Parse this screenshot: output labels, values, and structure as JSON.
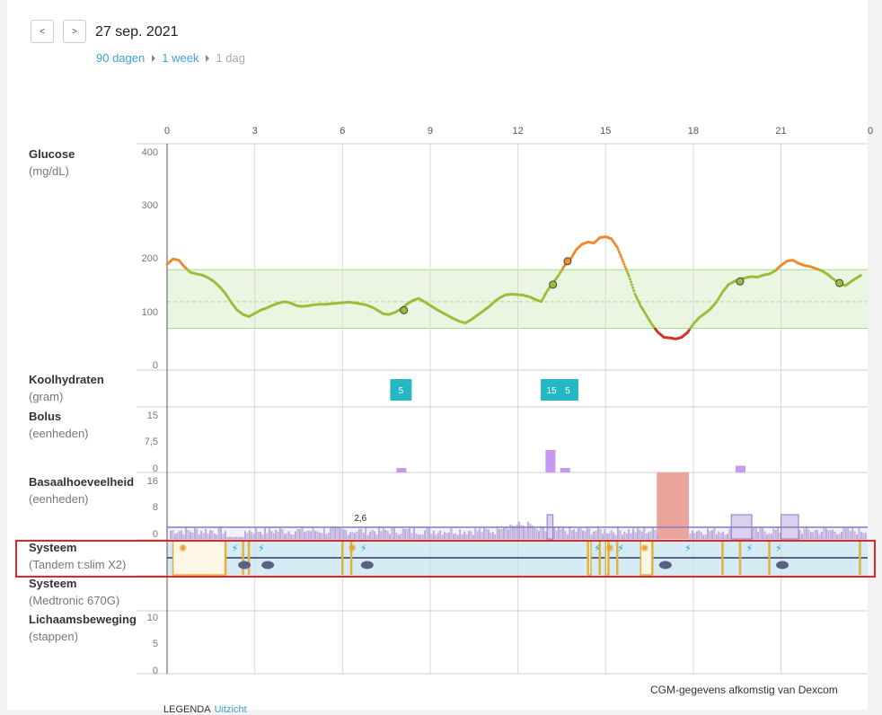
{
  "nav": {
    "prev_label": "<",
    "next_label": ">",
    "date": "27 sep. 2021"
  },
  "range": {
    "opt_90": "90 dagen",
    "opt_week": "1 week",
    "opt_day": "1 dag",
    "active": "1 dag"
  },
  "hours": [
    "0",
    "3",
    "6",
    "9",
    "12",
    "15",
    "18",
    "21"
  ],
  "rows": {
    "glucose": {
      "label": "Glucose",
      "unit": "(mg/dL)",
      "ticks": [
        "400",
        "300",
        "200",
        "100",
        "0"
      ]
    },
    "carbs": {
      "label": "Koolhydraten",
      "unit": "(gram)"
    },
    "bolus": {
      "label": "Bolus",
      "unit": "(eenheden)",
      "ticks": [
        "15",
        "7,5",
        "0"
      ]
    },
    "basal": {
      "label": "Basaalhoeveelheid",
      "unit": "(eenheden)",
      "ticks": [
        "16",
        "8",
        "0"
      ],
      "annotation": "2,6"
    },
    "system_tandem": {
      "label": "Systeem",
      "unit": "(Tandem t:slim X2)"
    },
    "system_medtronic": {
      "label": "Systeem",
      "unit": "(Medtronic 670G)"
    },
    "steps": {
      "label": "Lichaamsbeweging",
      "unit": "(stappen)",
      "ticks": [
        "10",
        "5",
        "0"
      ]
    }
  },
  "carb_entries": [
    {
      "hour": 8.0,
      "grams": "5"
    },
    {
      "hour": 13.15,
      "grams": "15"
    },
    {
      "hour": 13.7,
      "grams": "5"
    }
  ],
  "bolus_entries": [
    {
      "hour": 8.0,
      "units": 1.0
    },
    {
      "hour": 13.1,
      "units": 5.0
    },
    {
      "hour": 13.6,
      "units": 1.0
    },
    {
      "hour": 19.6,
      "units": 1.5
    }
  ],
  "target_range": {
    "low": 70,
    "high": 180,
    "target": 120
  },
  "glucose_points": [
    [
      0.0,
      190
    ],
    [
      0.2,
      200
    ],
    [
      0.4,
      198
    ],
    [
      0.6,
      185
    ],
    [
      0.8,
      175
    ],
    [
      1.0,
      172
    ],
    [
      1.2,
      170
    ],
    [
      1.4,
      165
    ],
    [
      1.6,
      158
    ],
    [
      1.8,
      148
    ],
    [
      2.0,
      135
    ],
    [
      2.2,
      118
    ],
    [
      2.4,
      104
    ],
    [
      2.6,
      96
    ],
    [
      2.8,
      92
    ],
    [
      3.0,
      98
    ],
    [
      3.2,
      104
    ],
    [
      3.4,
      108
    ],
    [
      3.6,
      113
    ],
    [
      3.8,
      117
    ],
    [
      4.0,
      120
    ],
    [
      4.2,
      118
    ],
    [
      4.4,
      113
    ],
    [
      4.6,
      111
    ],
    [
      4.8,
      112
    ],
    [
      5.0,
      114
    ],
    [
      5.2,
      115
    ],
    [
      5.4,
      115
    ],
    [
      5.6,
      116
    ],
    [
      5.8,
      117
    ],
    [
      6.0,
      118
    ],
    [
      6.2,
      119
    ],
    [
      6.4,
      118
    ],
    [
      6.6,
      116
    ],
    [
      6.8,
      114
    ],
    [
      7.0,
      110
    ],
    [
      7.2,
      104
    ],
    [
      7.4,
      97
    ],
    [
      7.6,
      96
    ],
    [
      7.8,
      100
    ],
    [
      8.0,
      106
    ],
    [
      8.2,
      115
    ],
    [
      8.4,
      122
    ],
    [
      8.6,
      126
    ],
    [
      8.8,
      120
    ],
    [
      9.0,
      113
    ],
    [
      9.2,
      106
    ],
    [
      9.4,
      100
    ],
    [
      9.6,
      94
    ],
    [
      9.8,
      88
    ],
    [
      10.0,
      83
    ],
    [
      10.2,
      80
    ],
    [
      10.4,
      86
    ],
    [
      10.6,
      94
    ],
    [
      10.8,
      102
    ],
    [
      11.0,
      110
    ],
    [
      11.2,
      120
    ],
    [
      11.4,
      128
    ],
    [
      11.6,
      133
    ],
    [
      11.8,
      134
    ],
    [
      12.0,
      133
    ],
    [
      12.2,
      132
    ],
    [
      12.4,
      129
    ],
    [
      12.6,
      124
    ],
    [
      12.8,
      120
    ],
    [
      13.0,
      140
    ],
    [
      13.2,
      155
    ],
    [
      13.4,
      170
    ],
    [
      13.6,
      188
    ],
    [
      13.8,
      200
    ],
    [
      14.0,
      218
    ],
    [
      14.2,
      228
    ],
    [
      14.4,
      232
    ],
    [
      14.6,
      230
    ],
    [
      14.8,
      240
    ],
    [
      15.0,
      242
    ],
    [
      15.2,
      238
    ],
    [
      15.4,
      222
    ],
    [
      15.6,
      195
    ],
    [
      15.8,
      168
    ],
    [
      16.0,
      135
    ],
    [
      16.2,
      112
    ],
    [
      16.4,
      94
    ],
    [
      16.6,
      76
    ],
    [
      16.8,
      62
    ],
    [
      17.0,
      53
    ],
    [
      17.2,
      52
    ],
    [
      17.4,
      50
    ],
    [
      17.6,
      53
    ],
    [
      17.8,
      62
    ],
    [
      18.0,
      78
    ],
    [
      18.2,
      90
    ],
    [
      18.4,
      98
    ],
    [
      18.6,
      107
    ],
    [
      18.8,
      120
    ],
    [
      19.0,
      138
    ],
    [
      19.2,
      152
    ],
    [
      19.4,
      158
    ],
    [
      19.6,
      162
    ],
    [
      19.8,
      165
    ],
    [
      20.0,
      167
    ],
    [
      20.2,
      166
    ],
    [
      20.4,
      170
    ],
    [
      20.6,
      172
    ],
    [
      20.8,
      178
    ],
    [
      21.0,
      188
    ],
    [
      21.2,
      196
    ],
    [
      21.4,
      198
    ],
    [
      21.6,
      192
    ],
    [
      21.8,
      188
    ],
    [
      22.0,
      186
    ],
    [
      22.2,
      182
    ],
    [
      22.4,
      178
    ],
    [
      22.6,
      171
    ],
    [
      22.8,
      162
    ],
    [
      23.0,
      155
    ],
    [
      23.2,
      150
    ],
    [
      23.4,
      158
    ],
    [
      23.6,
      165
    ],
    [
      23.75,
      170
    ]
  ],
  "fingersticks": [
    {
      "hour": 8.1,
      "value": 104
    },
    {
      "hour": 13.2,
      "value": 152
    },
    {
      "hour": 13.7,
      "value": 196
    },
    {
      "hour": 19.6,
      "value": 158
    },
    {
      "hour": 23.0,
      "value": 155
    }
  ],
  "temp_basal_block": {
    "start": 16.75,
    "end": 17.85,
    "rate": 16
  },
  "footer_note": "CGM-gegevens afkomstig van Dexcom",
  "legend_label": "LEGENDA",
  "legend_link": "Uitzicht",
  "colors": {
    "in_range": "#9cbd3a",
    "high": "#ef8a2e",
    "low": "#d0321f",
    "carb_box": "#26b8c2",
    "bolus_bar": "#c599f0",
    "basal_line": "#8b79c4",
    "basal_fill": "#d9d1ee",
    "temp_basal": "#eaa59a",
    "target_band": "#eaf6e2",
    "system_bg": "#d6ecf4",
    "highlight": "#e0262b"
  }
}
